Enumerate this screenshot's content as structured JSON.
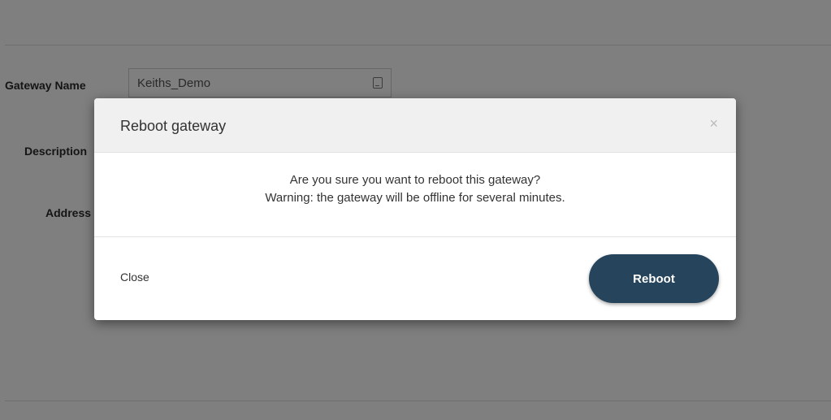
{
  "form": {
    "gateway_name_label": "Gateway Name",
    "gateway_name_value": "Keiths_Demo",
    "description_label": "Description",
    "address_label": "Address"
  },
  "modal": {
    "title": "Reboot gateway",
    "close_icon": "×",
    "message_line1": "Are you sure you want to reboot this gateway?",
    "message_line2": "Warning: the gateway will be offline for several minutes.",
    "close_label": "Close",
    "reboot_label": "Reboot"
  },
  "colors": {
    "primary_button": "#26445b",
    "backdrop": "rgba(0,0,0,0.5)"
  }
}
